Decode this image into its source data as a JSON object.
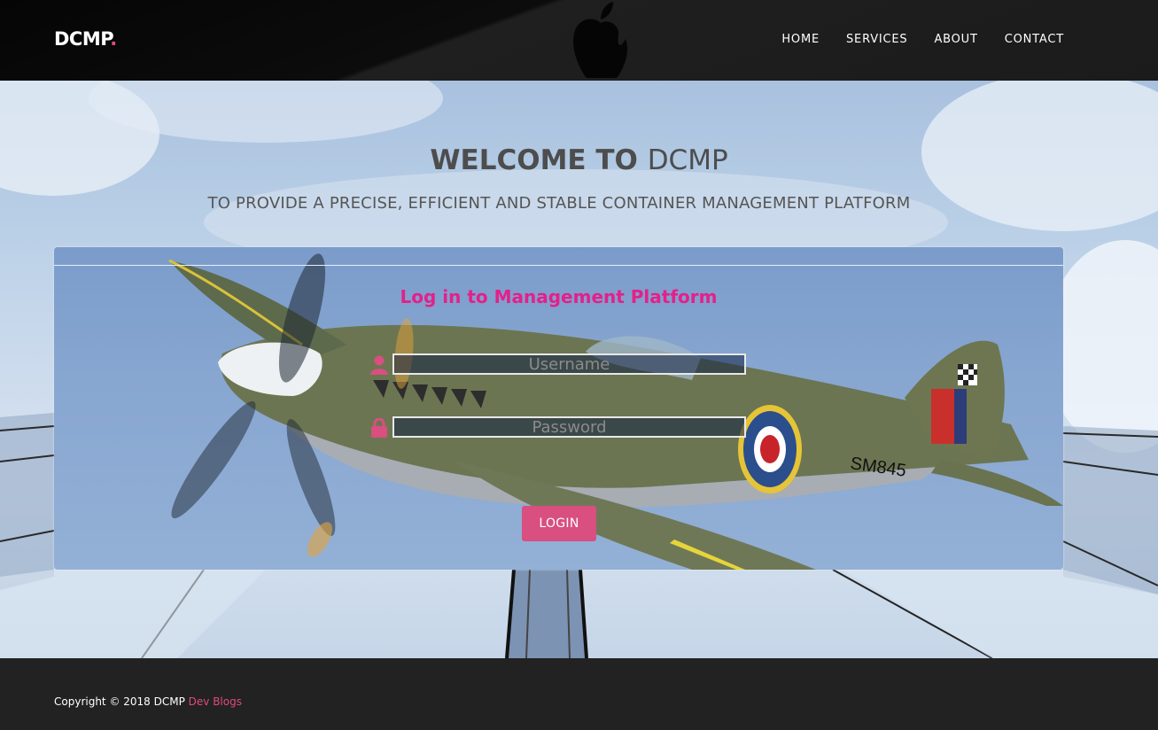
{
  "nav": {
    "brand": "DCMP",
    "brand_dot": ".",
    "links": [
      "HOME",
      "SERVICES",
      "ABOUT",
      "CONTACT"
    ]
  },
  "hero": {
    "welcome_bold": "WELCOME TO",
    "welcome_light": "DCMP",
    "tagline": "TO PROVIDE A PRECISE, EFFICIENT AND STABLE CONTAINER MANAGEMENT PLATFORM"
  },
  "login": {
    "title": "Log in to Management Platform",
    "username_placeholder": "Username",
    "password_placeholder": "Password",
    "button_label": "LOGIN"
  },
  "footer": {
    "copyright": "Copyright © 2018 DCMP",
    "link_label": "Dev Blogs"
  },
  "colors": {
    "accent": "#e24a7d",
    "title": "#e4208a",
    "button": "#d84f80",
    "footer_bg": "#222222"
  },
  "icons": [
    "apple-icon",
    "user-icon",
    "lock-icon"
  ]
}
